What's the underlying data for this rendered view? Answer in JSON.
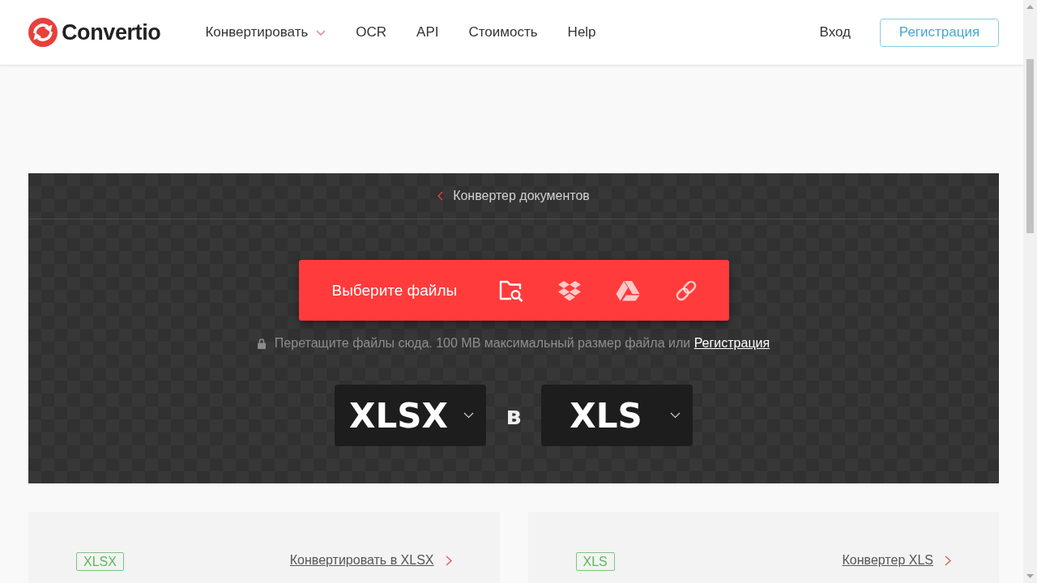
{
  "header": {
    "logo": "Convertio",
    "nav": [
      {
        "label": "Конвертировать",
        "dropdown": true
      },
      {
        "label": "OCR",
        "dropdown": false
      },
      {
        "label": "API",
        "dropdown": false
      },
      {
        "label": "Стоимость",
        "dropdown": false
      },
      {
        "label": "Help",
        "dropdown": false
      }
    ],
    "login": "Вход",
    "register": "Регистрация"
  },
  "converter": {
    "breadcrumb": "Конвертер документов",
    "upload_label": "Выберите файлы",
    "hint": "Перетащите файлы сюда. 100 MB максимальный размер файла или",
    "hint_link": "Регистрация",
    "from_format": "XLSX",
    "joiner": "в",
    "to_format": "XLS"
  },
  "cards": [
    {
      "tag": "XLSX",
      "link": "Конвертировать в XLSX"
    },
    {
      "tag": "XLS",
      "link": "Конвертер XLS"
    }
  ]
}
